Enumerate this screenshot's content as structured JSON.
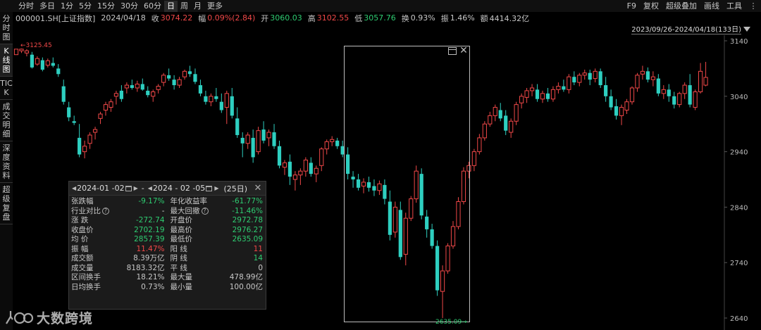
{
  "toolbar": {
    "periods": [
      "分时",
      "多日",
      "1分",
      "5分",
      "15分",
      "30分",
      "60分",
      "日",
      "周",
      "月",
      "更多"
    ],
    "active_period": "日",
    "right_items": [
      "F9",
      "复权",
      "超级叠加",
      "画线",
      "工具"
    ]
  },
  "quote": {
    "code": "000001.SH[上证指数]",
    "date": "2024/04/18",
    "close_label": "收",
    "close": "3074.22",
    "change_label": "幅",
    "change": "0.09%(2.84)",
    "open_label": "开",
    "open": "3060.03",
    "high_label": "高",
    "high": "3102.55",
    "low_label": "低",
    "low": "3057.76",
    "turnover_label": "换",
    "turnover": "0.93%",
    "amplitude_label": "振",
    "amplitude": "1.46%",
    "amount_label": "额",
    "amount": "4414.32亿"
  },
  "range_label": "2023/09/26-2024/04/18(133日)",
  "left_tabs": [
    "分时图",
    "K线图",
    "TICK",
    "成交明细",
    "深度资料",
    "超级复盘"
  ],
  "active_tab": "K线图",
  "colors": {
    "up": "#f04848",
    "down": "#2ecfc0",
    "bg": "#000000"
  },
  "chart_data": {
    "type": "candlestick",
    "price_axis": {
      "labels": [
        "3140",
        "3040",
        "2940",
        "2840",
        "2740",
        "2640"
      ],
      "min": 2640,
      "max": 3140
    },
    "high_marker": "3125.45",
    "low_marker": "2635.09",
    "candles": [
      [
        3115,
        3125,
        3118,
        3125
      ],
      [
        3122,
        3126,
        3118,
        3125
      ],
      [
        3118,
        3125,
        3112,
        3122
      ],
      [
        3115,
        3120,
        3090,
        3092
      ],
      [
        3098,
        3112,
        3095,
        3108
      ],
      [
        3105,
        3110,
        3085,
        3088
      ],
      [
        3096,
        3108,
        3092,
        3104
      ],
      [
        3100,
        3110,
        3092,
        3095
      ],
      [
        3090,
        3098,
        3075,
        3080
      ],
      [
        3058,
        3070,
        3025,
        3030
      ],
      [
        3020,
        3030,
        2995,
        3002
      ],
      [
        2995,
        3005,
        2988,
        2992
      ],
      [
        2965,
        2990,
        2930,
        2935
      ],
      [
        2940,
        2960,
        2928,
        2950
      ],
      [
        2955,
        2975,
        2945,
        2970
      ],
      [
        2975,
        2985,
        2962,
        2980
      ],
      [
        3000,
        3012,
        2990,
        3008
      ],
      [
        3015,
        3030,
        3005,
        3025
      ],
      [
        3020,
        3035,
        3012,
        3030
      ],
      [
        3040,
        3050,
        3025,
        3045
      ],
      [
        3050,
        3060,
        3030,
        3035
      ],
      [
        3055,
        3065,
        3045,
        3060
      ],
      [
        3060,
        3070,
        3052,
        3055
      ],
      [
        3055,
        3068,
        3048,
        3062
      ],
      [
        3062,
        3072,
        3050,
        3052
      ],
      [
        3050,
        3058,
        3038,
        3042
      ],
      [
        3040,
        3052,
        3030,
        3048
      ],
      [
        3052,
        3062,
        3045,
        3058
      ],
      [
        3065,
        3082,
        3058,
        3078
      ],
      [
        3078,
        3090,
        3068,
        3072
      ],
      [
        3070,
        3078,
        3052,
        3060
      ],
      [
        3060,
        3075,
        3055,
        3070
      ],
      [
        3075,
        3088,
        3070,
        3085
      ],
      [
        3085,
        3095,
        3075,
        3080
      ],
      [
        3080,
        3090,
        3062,
        3066
      ],
      [
        3060,
        3070,
        3040,
        3045
      ],
      [
        3040,
        3050,
        3025,
        3030
      ],
      [
        3030,
        3045,
        3022,
        3040
      ],
      [
        3040,
        3055,
        3030,
        3035
      ],
      [
        3030,
        3045,
        3010,
        3015
      ],
      [
        3020,
        3050,
        2990,
        3045
      ],
      [
        3040,
        3055,
        3000,
        3005
      ],
      [
        3000,
        3020,
        2965,
        2970
      ],
      [
        2965,
        2975,
        2930,
        2955
      ],
      [
        2955,
        2975,
        2945,
        2970
      ],
      [
        2965,
        2980,
        2920,
        2930
      ],
      [
        2940,
        2985,
        2935,
        2978
      ],
      [
        2980,
        2995,
        2955,
        2960
      ],
      [
        2965,
        2980,
        2950,
        2975
      ],
      [
        2975,
        2990,
        2945,
        2950
      ],
      [
        2950,
        2960,
        2910,
        2915
      ],
      [
        2912,
        2925,
        2898,
        2920
      ],
      [
        2922,
        2935,
        2880,
        2895
      ],
      [
        2890,
        2905,
        2870,
        2898
      ],
      [
        2898,
        2910,
        2880,
        2905
      ],
      [
        2905,
        2930,
        2895,
        2925
      ],
      [
        2920,
        2930,
        2895,
        2900
      ],
      [
        2900,
        2915,
        2885,
        2910
      ],
      [
        2915,
        2948,
        2905,
        2945
      ],
      [
        2945,
        2962,
        2935,
        2958
      ],
      [
        2958,
        2968,
        2950,
        2962
      ],
      [
        2960,
        2965,
        2945,
        2950
      ],
      [
        2950,
        2960,
        2930,
        2935
      ],
      [
        2935,
        2948,
        2890,
        2900
      ],
      [
        2895,
        2905,
        2875,
        2890
      ],
      [
        2890,
        2900,
        2870,
        2875
      ],
      [
        2878,
        2892,
        2865,
        2885
      ],
      [
        2885,
        2895,
        2868,
        2875
      ],
      [
        2878,
        2890,
        2860,
        2870
      ],
      [
        2870,
        2888,
        2862,
        2882
      ],
      [
        2880,
        2890,
        2845,
        2855
      ],
      [
        2850,
        2870,
        2780,
        2790
      ],
      [
        2795,
        2850,
        2785,
        2840
      ],
      [
        2835,
        2850,
        2745,
        2750
      ],
      [
        2755,
        2830,
        2735,
        2820
      ],
      [
        2820,
        2860,
        2815,
        2855
      ],
      [
        2855,
        2915,
        2848,
        2905
      ],
      [
        2900,
        2910,
        2818,
        2825
      ],
      [
        2823,
        2835,
        2785,
        2800
      ],
      [
        2800,
        2810,
        2765,
        2770
      ],
      [
        2770,
        2780,
        2680,
        2690
      ],
      [
        2688,
        2735,
        2640,
        2725
      ],
      [
        2725,
        2775,
        2720,
        2770
      ],
      [
        2770,
        2815,
        2765,
        2805
      ],
      [
        2805,
        2858,
        2800,
        2850
      ],
      [
        2850,
        2912,
        2845,
        2905
      ],
      [
        2905,
        2922,
        2892,
        2915
      ],
      [
        2915,
        2945,
        2905,
        2940
      ],
      [
        2940,
        2972,
        2935,
        2965
      ],
      [
        2965,
        2995,
        2960,
        2990
      ],
      [
        2990,
        3012,
        2985,
        3005
      ],
      [
        3005,
        3025,
        2995,
        3020
      ],
      [
        3015,
        3028,
        2995,
        3000
      ],
      [
        3005,
        3015,
        2970,
        2978
      ],
      [
        2975,
        3000,
        2965,
        2995
      ],
      [
        2995,
        3030,
        2988,
        3025
      ],
      [
        3028,
        3045,
        3018,
        3040
      ],
      [
        3038,
        3055,
        3028,
        3050
      ],
      [
        3050,
        3062,
        3040,
        3055
      ],
      [
        3052,
        3062,
        3030,
        3035
      ],
      [
        3035,
        3050,
        3028,
        3045
      ],
      [
        3045,
        3055,
        3030,
        3035
      ],
      [
        3035,
        3058,
        3030,
        3052
      ],
      [
        3052,
        3065,
        3045,
        3058
      ],
      [
        3058,
        3070,
        3048,
        3052
      ],
      [
        3052,
        3080,
        3045,
        3075
      ],
      [
        3075,
        3085,
        3060,
        3065
      ],
      [
        3065,
        3082,
        3058,
        3078
      ],
      [
        3078,
        3088,
        3070,
        3082
      ],
      [
        3082,
        3088,
        3060,
        3070
      ],
      [
        3072,
        3090,
        3065,
        3085
      ],
      [
        3085,
        3090,
        3055,
        3060
      ],
      [
        3060,
        3075,
        3030,
        3040
      ],
      [
        3040,
        3052,
        3015,
        3020
      ],
      [
        3022,
        3035,
        2998,
        3005
      ],
      [
        3005,
        3025,
        2988,
        3020
      ],
      [
        3015,
        3035,
        3008,
        3030
      ],
      [
        3030,
        3058,
        3025,
        3055
      ],
      [
        3055,
        3082,
        3048,
        3078
      ],
      [
        3080,
        3095,
        3070,
        3085
      ],
      [
        3085,
        3092,
        3065,
        3070
      ],
      [
        3070,
        3085,
        3058,
        3075
      ],
      [
        3072,
        3080,
        3040,
        3045
      ],
      [
        3045,
        3060,
        3035,
        3052
      ],
      [
        3052,
        3062,
        3030,
        3040
      ],
      [
        3040,
        3048,
        3018,
        3025
      ],
      [
        3025,
        3048,
        3020,
        3045
      ],
      [
        3045,
        3065,
        3035,
        3060
      ],
      [
        3060,
        3080,
        3020,
        3025
      ],
      [
        3020,
        3052,
        3015,
        3048
      ],
      [
        3048,
        3100,
        3045,
        3085
      ],
      [
        3060,
        3102,
        3058,
        3074
      ]
    ],
    "selection": {
      "start_index": 64,
      "end_index": 88
    }
  },
  "stats": {
    "start_date": "2024-01 -02",
    "dash": "-",
    "end_date": "2024 - 02 -05",
    "days": "(25日)",
    "rows": [
      {
        "lk": "张跌幅",
        "lv": "-9.17%",
        "lc": "green",
        "rk": "年化收益率",
        "rv": "-61.77%",
        "rc": "green"
      },
      {
        "lk": "行业对比",
        "lq": true,
        "lv": "-",
        "lc": "gray",
        "rk": "最大回撤",
        "rq": true,
        "rv": "-11.46%",
        "rc": "green"
      },
      {
        "lk": "涨 跌",
        "lv": "-272.74",
        "lc": "green",
        "rk": "开盘价",
        "rv": "2972.78",
        "rc": "green"
      },
      {
        "lk": "收盘价",
        "lv": "2702.19",
        "lc": "green",
        "rk": "最高价",
        "rv": "2976.27",
        "rc": "green"
      },
      {
        "lk": "均 价",
        "lv": "2857.39",
        "lc": "green",
        "rk": "最低价",
        "rv": "2635.09",
        "rc": "green"
      },
      {
        "lk": "振 幅",
        "lv": "11.47%",
        "lc": "red",
        "rk": "阳 线",
        "rv": "11",
        "rc": "red"
      },
      {
        "lk": "成交额",
        "lv": "8.39万亿",
        "lc": "gray",
        "rk": "阴 线",
        "rv": "14",
        "rc": "green"
      },
      {
        "lk": "成交量",
        "lv": "8183.32亿",
        "lc": "gray",
        "rk": "平 线",
        "rv": "0",
        "rc": "gray"
      },
      {
        "lk": "区间换手",
        "lv": "18.21%",
        "lc": "gray",
        "rk": "最大量",
        "rv": "478.99亿",
        "rc": "gray"
      },
      {
        "lk": "日均换手",
        "lv": "0.73%",
        "lc": "gray",
        "rk": "最小量",
        "rv": "100.00亿",
        "rc": "gray"
      }
    ]
  },
  "watermark": {
    "text": "大数跨境"
  }
}
